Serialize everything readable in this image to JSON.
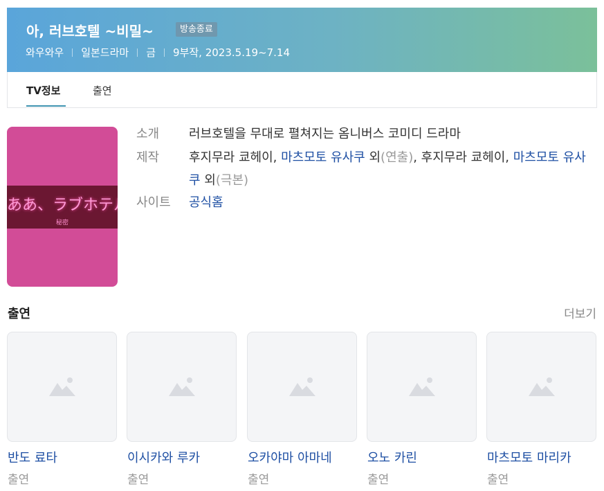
{
  "header": {
    "title": "아, 러브호텔 ~비밀~",
    "badge": "방송종료",
    "meta": [
      "와우와우",
      "일본드라마",
      "금",
      "9부작, 2023.5.19~7.14"
    ]
  },
  "tabs": [
    {
      "label": "TV정보",
      "active": true
    },
    {
      "label": "출연",
      "active": false
    }
  ],
  "poster": {
    "text": "ああ、ラブホテル",
    "sub": "秘密"
  },
  "info": {
    "intro": {
      "label": "소개",
      "value": "러브호텔을 무대로 펼쳐지는 옴니버스 코미디 드라마"
    },
    "production": {
      "label": "제작",
      "p1": "후지무라 쿄헤이, ",
      "link1": "마츠모토 유사쿠",
      "p2": " 외",
      "note1": "(연출)",
      "p3": ", 후지무라 쿄헤이, ",
      "link2": "마츠모토 유사쿠",
      "p4": " 외",
      "note2": "(극본)"
    },
    "site": {
      "label": "사이트",
      "value": "공식홈"
    }
  },
  "cast": {
    "title": "출연",
    "more": "더보기",
    "items": [
      {
        "name": "반도 료타",
        "role": "출연"
      },
      {
        "name": "이시카와 루카",
        "role": "출연"
      },
      {
        "name": "오카야마 아마네",
        "role": "출연"
      },
      {
        "name": "오노 카린",
        "role": "출연"
      },
      {
        "name": "마츠모토 마리카",
        "role": "출연"
      }
    ]
  },
  "colors": {
    "accent": "#3f93b0",
    "link": "#1e4fa3",
    "header_start": "#5aa5da",
    "header_end": "#7bc09a"
  }
}
